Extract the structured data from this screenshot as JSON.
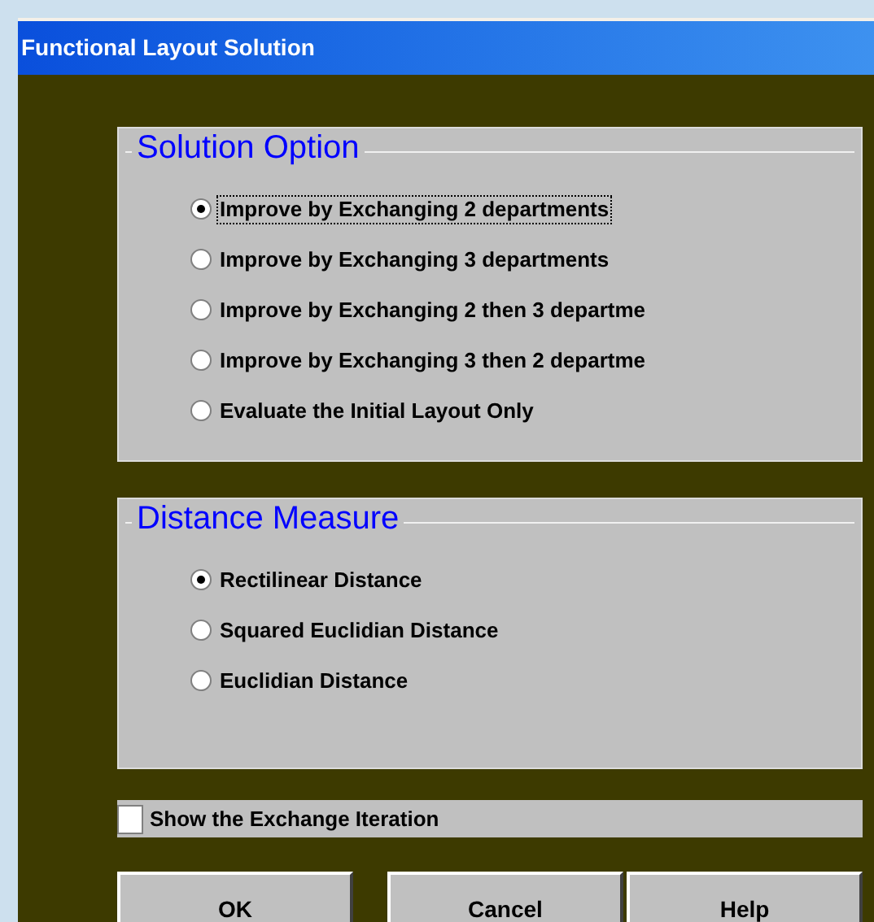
{
  "window": {
    "title": "Functional Layout Solution"
  },
  "solution_option": {
    "title": "Solution Option",
    "options": [
      {
        "label": "Improve by Exchanging 2 departments",
        "selected": true,
        "focused": true
      },
      {
        "label": "Improve by Exchanging 3 departments",
        "selected": false,
        "focused": false
      },
      {
        "label": "Improve by Exchanging 2 then 3 departme",
        "selected": false,
        "focused": false
      },
      {
        "label": "Improve by Exchanging 3 then 2 departme",
        "selected": false,
        "focused": false
      },
      {
        "label": "Evaluate the Initial Layout Only",
        "selected": false,
        "focused": false
      }
    ]
  },
  "distance_measure": {
    "title": "Distance Measure",
    "options": [
      {
        "label": "Rectilinear Distance",
        "selected": true,
        "focused": false
      },
      {
        "label": "Squared Euclidian Distance",
        "selected": false,
        "focused": false
      },
      {
        "label": "Euclidian Distance",
        "selected": false,
        "focused": false
      }
    ]
  },
  "show_iteration": {
    "label": "Show the Exchange Iteration",
    "checked": false
  },
  "buttons": [
    "OK",
    "Cancel",
    "Help"
  ]
}
